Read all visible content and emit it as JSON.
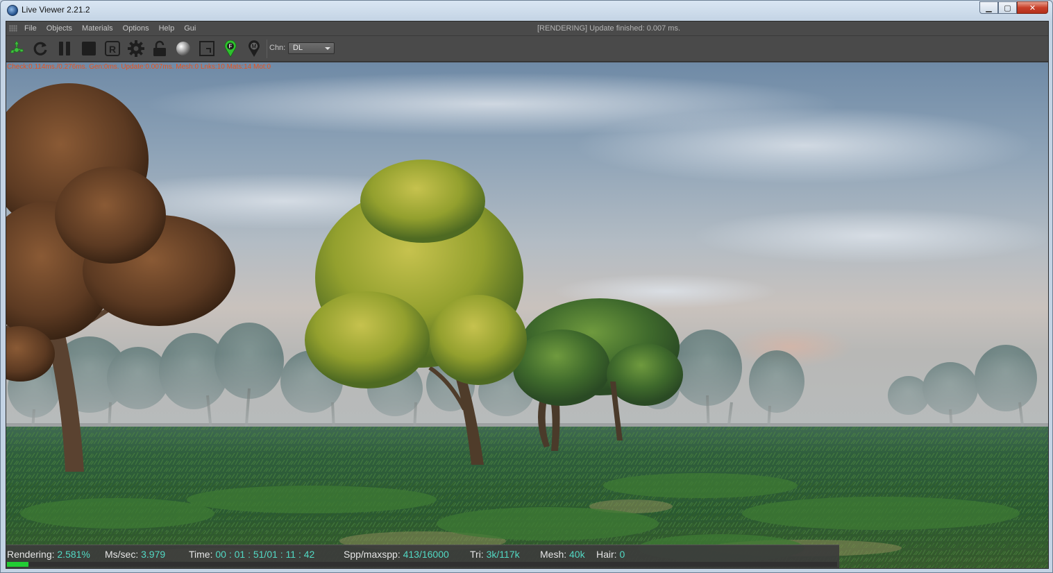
{
  "window": {
    "title": "Live Viewer 2.21.2",
    "minimize_glyph": "▁",
    "maximize_glyph": "▢",
    "close_glyph": "✕"
  },
  "menubar": {
    "items": [
      "File",
      "Objects",
      "Materials",
      "Options",
      "Help",
      "Gui"
    ],
    "status": "[RENDERING] Update finished: 0.007 ms."
  },
  "toolbar": {
    "icons": [
      "recycle-icon",
      "refresh-icon",
      "pause-icon",
      "stop-icon",
      "render-region-icon",
      "settings-gear-icon",
      "lock-icon",
      "material-ball-icon",
      "crop-frame-icon",
      "focus-pin-icon",
      "material-pin-icon"
    ],
    "focus_pin_letter": "F",
    "material_pin_letter": "M",
    "channel_label": "Chn:",
    "channel_value": "DL"
  },
  "viewport": {
    "stats_line": "Check:0.114ms./0.276ms. Gen:0ms. Update:0.007ms. Mesh:0 Lnks:10 Mats:14 Mot:0"
  },
  "render_stats": {
    "rendering_label": "Rendering:",
    "rendering_value": "2.581%",
    "progress_fraction": 0.02581,
    "mssec_label": "Ms/sec:",
    "mssec_value": "3.979",
    "time_label": "Time:",
    "time_value": "00 : 01 : 51/01 : 11 : 42",
    "spp_label": "Spp/maxspp:",
    "spp_value": "413/16000",
    "tri_label": "Tri:",
    "tri_value": "3k/117k",
    "mesh_label": "Mesh:",
    "mesh_value": "40k",
    "hair_label": "Hair:",
    "hair_value": "0"
  },
  "colors": {
    "accent_green": "#22cc33",
    "stat_value": "#52d9c4",
    "stats_line": "#e8521c"
  }
}
